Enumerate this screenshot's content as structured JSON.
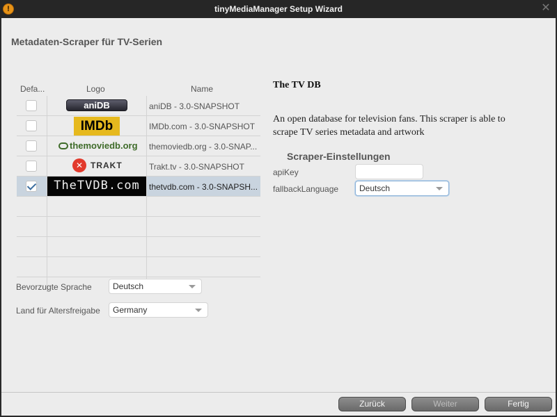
{
  "window": {
    "title": "tinyMediaManager Setup Wizard"
  },
  "page": {
    "heading": "Metadaten-Scraper für TV-Serien"
  },
  "table": {
    "columns": [
      "Defa...",
      "Logo",
      "Name"
    ],
    "rows": [
      {
        "default": false,
        "logo_text": "aniDB",
        "name": "aniDB - 3.0-SNAPSHOT",
        "selected": false
      },
      {
        "default": false,
        "logo_text": "IMDb",
        "name": "IMDb.com - 3.0-SNAPSHOT",
        "selected": false
      },
      {
        "default": false,
        "logo_text": "themoviedb.org",
        "name": "themoviedb.org - 3.0-SNAP...",
        "selected": false
      },
      {
        "default": false,
        "logo_text": "TRAKT",
        "name": "Trakt.tv - 3.0-SNAPSHOT",
        "selected": false
      },
      {
        "default": true,
        "logo_text": "TheTVDB.com",
        "name": "thetvdb.com - 3.0-SNAPSH...",
        "selected": true
      }
    ]
  },
  "detail": {
    "title": "The TV DB",
    "description": "An open database for television fans. This scraper is able to scrape TV series metadata and artwork",
    "settings_title": "Scraper-Einstellungen",
    "api_key_label": "apiKey",
    "api_key_value": "",
    "fallback_label": "fallbackLanguage",
    "fallback_value": "Deutsch"
  },
  "preferences": {
    "language_label": "Bevorzugte Sprache",
    "language_value": "Deutsch",
    "country_label": "Land für Altersfreigabe",
    "country_value": "Germany"
  },
  "footer": {
    "back_label": "Zurück",
    "next_label": "Weiter",
    "finish_label": "Fertig"
  },
  "colors": {
    "app_icon": "#e69318",
    "selection": "#c9d4df",
    "button": "#7a7a7a"
  }
}
